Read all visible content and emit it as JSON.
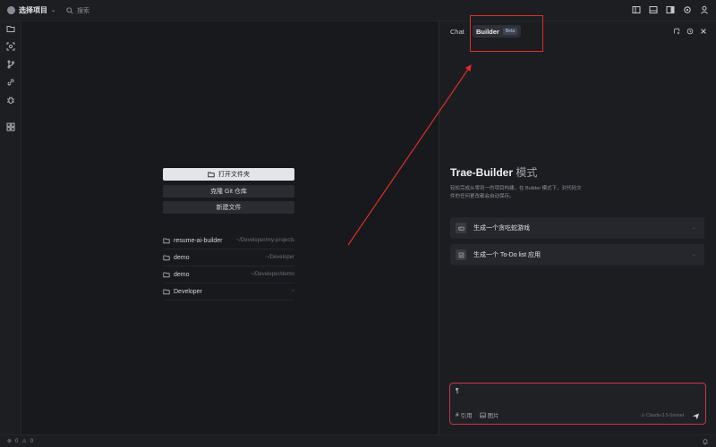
{
  "topbar": {
    "project": "选择项目",
    "search_placeholder": "搜索"
  },
  "welcome": {
    "open_folder": "打开文件夹",
    "clone_git": "克隆 Git 仓库",
    "new_file": "新建文件",
    "recent": [
      {
        "name": "resume-ai-builder",
        "path": "~/Developer/my-projects"
      },
      {
        "name": "demo",
        "path": "~/Developer"
      },
      {
        "name": "demo",
        "path": "~/Developer/demo"
      },
      {
        "name": "Developer",
        "path": "~"
      }
    ]
  },
  "panel": {
    "tab_chat": "Chat",
    "tab_builder": "Builder",
    "beta": "Beta",
    "title": "Trae-Builder",
    "title_suffix": "模式",
    "description": "轻松完成从零到一的项目构建。在 Builder 模式下，对代码文件的任何更改都会自动保存。",
    "suggestions": [
      "生成一个贪吃蛇游戏",
      "生成一个 To-Do list 应用"
    ],
    "composer_value": "¶",
    "ref_label": "引用",
    "image_label": "图片",
    "model": "Claude-3.5-Sonnet"
  },
  "status": {
    "errors": "0",
    "warnings": "0"
  },
  "colors": {
    "annotation": "#e02c2c",
    "composer_border": "#c9364a"
  }
}
